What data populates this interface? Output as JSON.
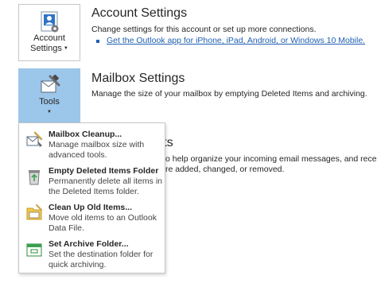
{
  "account": {
    "tile_line1": "Account",
    "tile_line2": "Settings",
    "title": "Account Settings",
    "description": "Change settings for this account or set up more connections.",
    "link": "Get the Outlook app for iPhone, iPad, Android, or Windows 10 Mobile."
  },
  "mailbox": {
    "tile_label": "Tools",
    "title": "Mailbox Settings",
    "description": "Manage the size of your mailbox by emptying Deleted Items and archiving."
  },
  "rules": {
    "title_fragment": "rts",
    "desc_line1": "o help organize your incoming email messages, and receive",
    "desc_line2": "re added, changed, or removed."
  },
  "tools_menu": [
    {
      "icon": "mailbox-cleanup-icon",
      "title": "Mailbox Cleanup...",
      "description": "Manage mailbox size with advanced tools."
    },
    {
      "icon": "recycle-bin-icon",
      "title": "Empty Deleted Items Folder",
      "description": "Permanently delete all items in the Deleted Items folder."
    },
    {
      "icon": "clean-up-old-items-icon",
      "title": "Clean Up Old Items...",
      "description": "Move old items to an Outlook Data File."
    },
    {
      "icon": "archive-folder-icon",
      "title": "Set Archive Folder...",
      "description": "Set the destination folder for quick archiving."
    }
  ],
  "colors": {
    "link": "#1f5fb1",
    "tile_pressed": "#9cc6ea",
    "tile_border": "#c6c6c6"
  }
}
